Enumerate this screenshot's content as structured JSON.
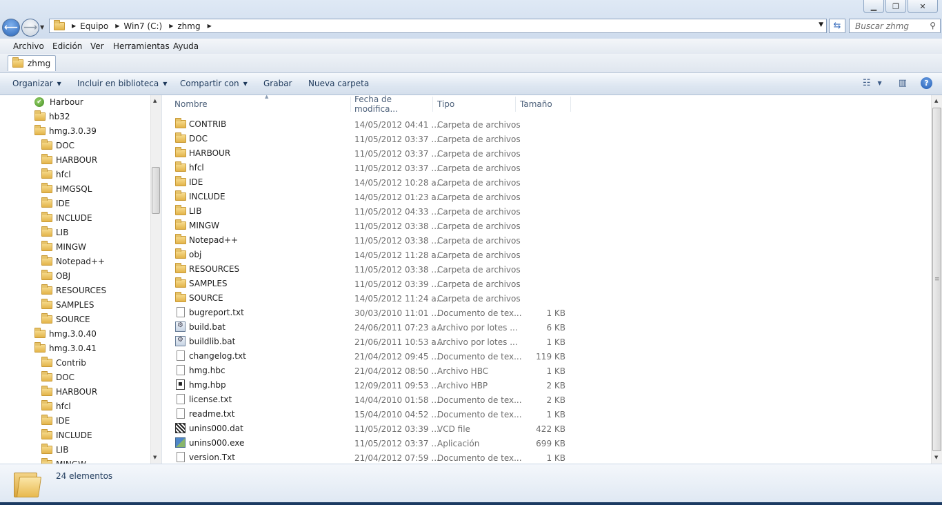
{
  "window": {
    "controls": [
      "minimize-icon",
      "restore-icon",
      "close-icon"
    ],
    "accent_color": "#2a65b7"
  },
  "address": {
    "crumbs": [
      "Equipo",
      "Win7 (C:)",
      "zhmg"
    ],
    "search_placeholder": "Buscar zhmg"
  },
  "menu": [
    "Archivo",
    "Edición",
    "Ver",
    "Herramientas",
    "Ayuda"
  ],
  "tab": {
    "label": "zhmg"
  },
  "toolbar": {
    "organize": "Organizar",
    "include": "Incluir en biblioteca",
    "share": "Compartir con",
    "burn": "Grabar",
    "new_folder": "Nueva carpeta"
  },
  "nav_tree": [
    {
      "label": "Harbour",
      "level": 0,
      "icon": "harbour-icon"
    },
    {
      "label": "hb32",
      "level": 0,
      "icon": "folder-icon"
    },
    {
      "label": "hmg.3.0.39",
      "level": 0,
      "icon": "folder-icon"
    },
    {
      "label": "DOC",
      "level": 1,
      "icon": "folder-icon"
    },
    {
      "label": "HARBOUR",
      "level": 1,
      "icon": "folder-icon"
    },
    {
      "label": "hfcl",
      "level": 1,
      "icon": "folder-icon"
    },
    {
      "label": "HMGSQL",
      "level": 1,
      "icon": "folder-icon"
    },
    {
      "label": "IDE",
      "level": 1,
      "icon": "folder-icon"
    },
    {
      "label": "INCLUDE",
      "level": 1,
      "icon": "folder-icon"
    },
    {
      "label": "LIB",
      "level": 1,
      "icon": "folder-icon"
    },
    {
      "label": "MINGW",
      "level": 1,
      "icon": "folder-icon"
    },
    {
      "label": "Notepad++",
      "level": 1,
      "icon": "folder-icon"
    },
    {
      "label": "OBJ",
      "level": 1,
      "icon": "folder-icon"
    },
    {
      "label": "RESOURCES",
      "level": 1,
      "icon": "folder-icon"
    },
    {
      "label": "SAMPLES",
      "level": 1,
      "icon": "folder-icon"
    },
    {
      "label": "SOURCE",
      "level": 1,
      "icon": "folder-icon"
    },
    {
      "label": "hmg.3.0.40",
      "level": 0,
      "icon": "folder-icon"
    },
    {
      "label": "hmg.3.0.41",
      "level": 0,
      "icon": "folder-icon"
    },
    {
      "label": "Contrib",
      "level": 1,
      "icon": "folder-icon"
    },
    {
      "label": "DOC",
      "level": 1,
      "icon": "folder-icon"
    },
    {
      "label": "HARBOUR",
      "level": 1,
      "icon": "folder-icon"
    },
    {
      "label": "hfcl",
      "level": 1,
      "icon": "folder-icon"
    },
    {
      "label": "IDE",
      "level": 1,
      "icon": "folder-icon"
    },
    {
      "label": "INCLUDE",
      "level": 1,
      "icon": "folder-icon"
    },
    {
      "label": "LIB",
      "level": 1,
      "icon": "folder-icon"
    },
    {
      "label": "MINGW",
      "level": 1,
      "icon": "folder-icon"
    }
  ],
  "columns": {
    "name": "Nombre",
    "date": "Fecha de modifica...",
    "type": "Tipo",
    "size": "Tamaño"
  },
  "files": [
    {
      "name": "CONTRIB",
      "date": "14/05/2012 04:41 ...",
      "type": "Carpeta de archivos",
      "size": "",
      "icon": "folder-icon"
    },
    {
      "name": "DOC",
      "date": "11/05/2012 03:37 ...",
      "type": "Carpeta de archivos",
      "size": "",
      "icon": "folder-icon"
    },
    {
      "name": "HARBOUR",
      "date": "11/05/2012 03:37 ...",
      "type": "Carpeta de archivos",
      "size": "",
      "icon": "folder-icon"
    },
    {
      "name": "hfcl",
      "date": "11/05/2012 03:37 ...",
      "type": "Carpeta de archivos",
      "size": "",
      "icon": "folder-icon"
    },
    {
      "name": "IDE",
      "date": "14/05/2012 10:28 a...",
      "type": "Carpeta de archivos",
      "size": "",
      "icon": "folder-icon"
    },
    {
      "name": "INCLUDE",
      "date": "14/05/2012 01:23 a...",
      "type": "Carpeta de archivos",
      "size": "",
      "icon": "folder-icon"
    },
    {
      "name": "LIB",
      "date": "11/05/2012 04:33 ...",
      "type": "Carpeta de archivos",
      "size": "",
      "icon": "folder-icon"
    },
    {
      "name": "MINGW",
      "date": "11/05/2012 03:38 ...",
      "type": "Carpeta de archivos",
      "size": "",
      "icon": "folder-icon"
    },
    {
      "name": "Notepad++",
      "date": "11/05/2012 03:38 ...",
      "type": "Carpeta de archivos",
      "size": "",
      "icon": "folder-icon"
    },
    {
      "name": "obj",
      "date": "14/05/2012 11:28 a...",
      "type": "Carpeta de archivos",
      "size": "",
      "icon": "folder-icon"
    },
    {
      "name": "RESOURCES",
      "date": "11/05/2012 03:38 ...",
      "type": "Carpeta de archivos",
      "size": "",
      "icon": "folder-icon"
    },
    {
      "name": "SAMPLES",
      "date": "11/05/2012 03:39 ...",
      "type": "Carpeta de archivos",
      "size": "",
      "icon": "folder-icon"
    },
    {
      "name": "SOURCE",
      "date": "14/05/2012 11:24 a...",
      "type": "Carpeta de archivos",
      "size": "",
      "icon": "folder-icon"
    },
    {
      "name": "bugreport.txt",
      "date": "30/03/2010 11:01 ...",
      "type": "Documento de tex...",
      "size": "1 KB",
      "icon": "text-file-icon"
    },
    {
      "name": "build.bat",
      "date": "24/06/2011 07:23 a...",
      "type": "Archivo por lotes ...",
      "size": "6 KB",
      "icon": "batch-file-icon"
    },
    {
      "name": "buildlib.bat",
      "date": "21/06/2011 10:53 a...",
      "type": "Archivo por lotes ...",
      "size": "1 KB",
      "icon": "batch-file-icon"
    },
    {
      "name": "changelog.txt",
      "date": "21/04/2012 09:45 ...",
      "type": "Documento de tex...",
      "size": "119 KB",
      "icon": "text-file-icon"
    },
    {
      "name": "hmg.hbc",
      "date": "21/04/2012 08:50 ...",
      "type": "Archivo HBC",
      "size": "1 KB",
      "icon": "text-file-icon"
    },
    {
      "name": "hmg.hbp",
      "date": "12/09/2011 09:53 ...",
      "type": "Archivo HBP",
      "size": "2 KB",
      "icon": "hbp-file-icon"
    },
    {
      "name": "license.txt",
      "date": "14/04/2010 01:58 ...",
      "type": "Documento de tex...",
      "size": "2 KB",
      "icon": "text-file-icon"
    },
    {
      "name": "readme.txt",
      "date": "15/04/2010 04:52 ...",
      "type": "Documento de tex...",
      "size": "1 KB",
      "icon": "text-file-icon"
    },
    {
      "name": "unins000.dat",
      "date": "11/05/2012 03:39 ...",
      "type": "VCD file",
      "size": "422 KB",
      "icon": "vcd-file-icon"
    },
    {
      "name": "unins000.exe",
      "date": "11/05/2012 03:37 ...",
      "type": "Aplicación",
      "size": "699 KB",
      "icon": "exe-file-icon"
    },
    {
      "name": "version.Txt",
      "date": "21/04/2012 07:59 ...",
      "type": "Documento de tex...",
      "size": "1 KB",
      "icon": "text-file-icon"
    }
  ],
  "details": {
    "count": "24 elementos"
  }
}
